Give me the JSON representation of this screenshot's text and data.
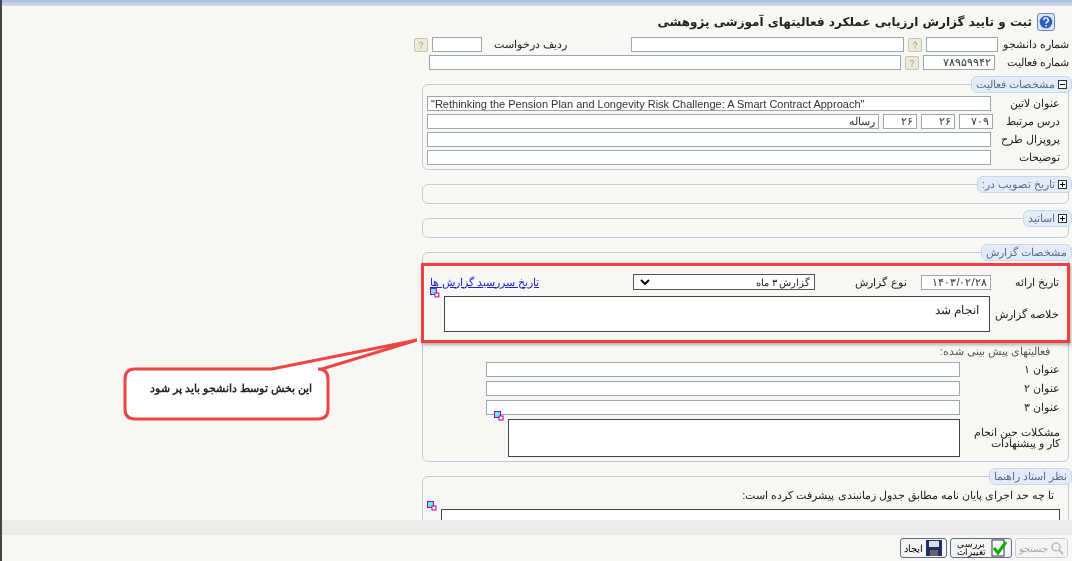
{
  "title": "ثبت و تایید گزارش ارزیابی عملکرد فعالیتهای آموزشی پژوهشی",
  "header": {
    "student_number": {
      "label": "شماره دانشجو"
    },
    "request_row": {
      "label": "ردیف درخواست"
    },
    "activity_number": {
      "label": "شماره فعالیت",
      "value": "۷۸۹۵۹۹۴۲"
    }
  },
  "activity_section": {
    "legend": "مشخصات فعالیت",
    "expanded": true,
    "latin_title": {
      "label": "عنوان لاتین",
      "value": "\"Rethinking the Pension Plan and Longevity Risk Challenge: A Smart Contract Approach\""
    },
    "related_course": {
      "label": "درس مرتبط",
      "values": [
        "۷۰۹",
        "۲۶",
        "۲۶",
        "رساله"
      ]
    },
    "proposal": {
      "label": "پروپزال طرح"
    },
    "description": {
      "label": "توضیحات"
    }
  },
  "collapsed_sections": [
    {
      "legend": "تاریخ تصویب در:",
      "expanded": false
    },
    {
      "legend": "اساتید",
      "expanded": false
    }
  ],
  "report_section": {
    "legend": "مشخصات گزارش",
    "date": {
      "label": "تاریخ ارائه",
      "value": "۱۴۰۳/۰۲/۲۸"
    },
    "report_type": {
      "label": "نوع گزارش",
      "value": "گزارش ۳ ماه"
    },
    "due_dates_link": "تاریخ سررسید گزارش ها",
    "summary": {
      "label": "خلاصه گزارش",
      "value": "انجام شد"
    },
    "planned_heading": "فعالیتهای پیش بینی شده:",
    "planned_items": [
      {
        "label": "عنوان ۱"
      },
      {
        "label": "عنوان ۲"
      },
      {
        "label": "عنوان ۳"
      }
    ],
    "problems": {
      "label": "مشکلات حین انجام کار و پیشنهادات"
    }
  },
  "advisor_section": {
    "legend": "نظر استاد راهنما",
    "question": "تا چه حد اجرای پایان نامه مطابق جدول زمانبندی پیشرفت کرده است:"
  },
  "buttons": [
    {
      "kind": "search",
      "label": "جستجو",
      "disabled": true
    },
    {
      "kind": "review",
      "label": "بررسی تغییرات",
      "disabled": false
    },
    {
      "kind": "save",
      "label": "ایجاد",
      "disabled": false
    }
  ],
  "callout": "این بخش توسط دانشجو باید پر شود"
}
